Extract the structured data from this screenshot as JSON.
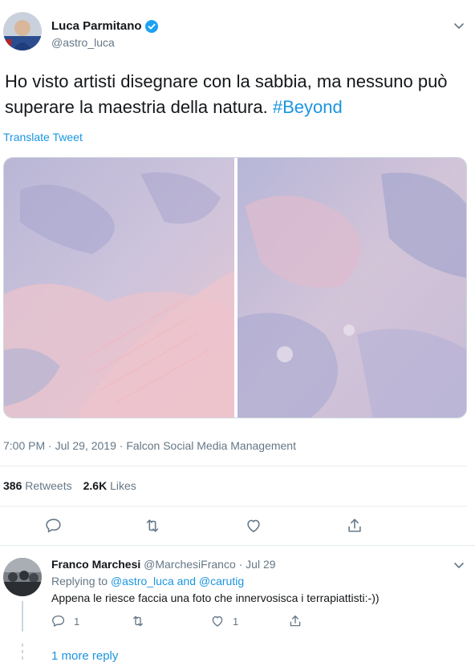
{
  "tweet": {
    "author_name": "Luca Parmitano",
    "author_handle": "@astro_luca",
    "text_main": "Ho visto artisti disegnare con la sabbia, ma nessuno può superare la maestria della natura. ",
    "hashtag": "#Beyond",
    "translate_label": "Translate Tweet",
    "time": "7:00 PM · Jul 29, 2019 · ",
    "source": "Falcon Social Media Management",
    "retweets_count": "386",
    "retweets_label": "Retweets",
    "likes_count": "2.6K",
    "likes_label": "Likes"
  },
  "reply": {
    "author_name": "Franco Marchesi",
    "author_handle": "@MarchesiFranco",
    "date": " · Jul 29",
    "replying_prefix": "Replying to ",
    "mention_1": "@astro_luca",
    "and_label": " and ",
    "mention_2": "@carutig",
    "text": "Appena le riesce faccia una foto che innervosisca i terrapiattisti:-))",
    "reply_count": "1",
    "like_count": "1",
    "more_reply_label": "1 more reply"
  },
  "colors": {
    "link": "#1b95e0",
    "verified": "#1da1f2",
    "secondary_text": "#657786"
  },
  "icons": [
    "verified-badge-icon",
    "chevron-down-icon",
    "reply-icon",
    "retweet-icon",
    "like-icon",
    "share-icon"
  ]
}
